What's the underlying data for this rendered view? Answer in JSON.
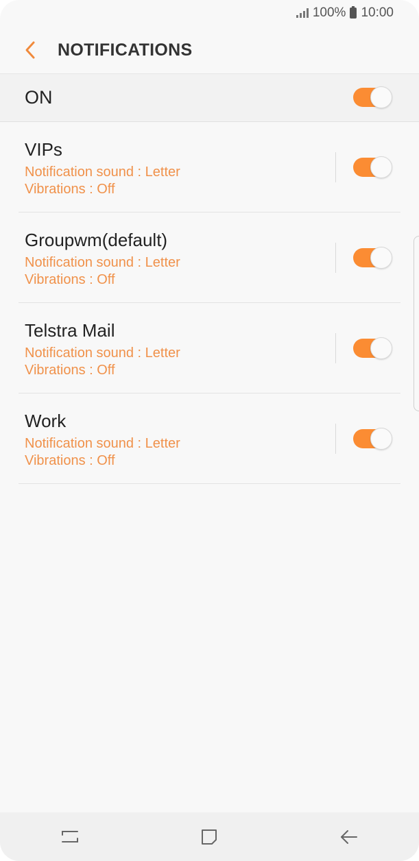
{
  "status_bar": {
    "battery_text": "100%",
    "time": "10:00",
    "icons": [
      "signal-icon",
      "battery-icon"
    ]
  },
  "header": {
    "title": "NOTIFICATIONS",
    "back_icon": "chevron-left-icon"
  },
  "master": {
    "label": "ON",
    "enabled": true
  },
  "accounts": [
    {
      "name": "VIPs",
      "sound": "Notification sound : Letter",
      "vibrations": "Vibrations : Off",
      "enabled": true
    },
    {
      "name": "Groupwm(default)",
      "sound": "Notification sound : Letter",
      "vibrations": "Vibrations : Off",
      "enabled": true
    },
    {
      "name": "Telstra Mail",
      "sound": "Notification sound : Letter",
      "vibrations": "Vibrations : Off",
      "enabled": true
    },
    {
      "name": "Work",
      "sound": "Notification sound : Letter",
      "vibrations": "Vibrations : Off",
      "enabled": true
    }
  ],
  "nav_bar": {
    "icons": [
      "recent-apps-icon",
      "home-icon",
      "back-arrow-icon"
    ]
  },
  "colors": {
    "accent": "#fb8c33",
    "subtext": "#f0914a",
    "background": "#f8f8f8"
  }
}
